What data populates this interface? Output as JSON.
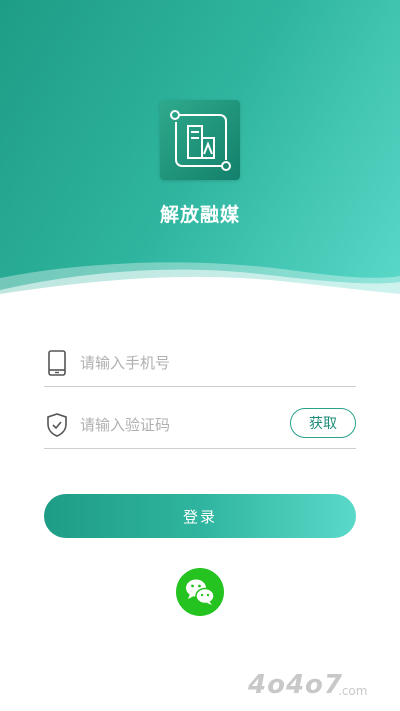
{
  "app": {
    "name": "解放融媒"
  },
  "login": {
    "phone_placeholder": "请输入手机号",
    "code_placeholder": "请输入验证码",
    "get_code_label": "获取",
    "submit_label": "登录"
  },
  "third_party": {
    "icon": "wechat-icon"
  },
  "colors": {
    "brand_start": "#1e9c86",
    "brand_end": "#5ad9c9",
    "wechat_green": "#25c320"
  },
  "watermark": {
    "text": "4o4o7.com"
  }
}
